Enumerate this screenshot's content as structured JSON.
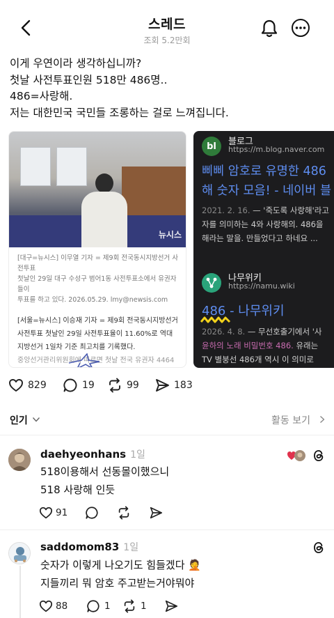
{
  "header": {
    "title": "스레드",
    "views": "조회 5.2만회"
  },
  "post": {
    "lines": [
      "이게 우연이라 생각하십니까?",
      "첫날 사전투표인원 518만 486명..",
      "486=사랑해.",
      "저는 대한민국 국민들 조롱하는 걸로 느껴집니다."
    ],
    "news_card": {
      "photo_mark": "뉴시스",
      "caption": "[대구=뉴시스] 이무열 기자 = 제9회 전국동시지방선거 사전투표 첫날인 29일 대구 수성구 범어1동 사전투표소에서 유권자들이 투표를 하고 있다. 2026.05.29. lmy@newsis.com",
      "caption_lines": [
        "[대구=뉴시스] 이무열 기자 = 제9회 전국동시지방선거 사전투표",
        "첫날인 29일 대구 수성구 범어1동 사전투표소에서 유권자들이",
        "투표를 하고 있다. 2026.05.29. lmy@newsis.com"
      ],
      "article_lines": [
        "[서울=뉴시스] 이승재 기자 = 제9회 전국동시지방선거",
        "사전투표 첫날인 29일 사전투표율이 11.60%로 역대",
        "지방선거 1일차 기준 최고치를 기록했다.",
        "중앙선거관리위원회에 따르면 첫날 전국 유권자 4464"
      ]
    },
    "search_card": {
      "blog_icon": "bl",
      "blog_name": "블로그",
      "blog_url": "https://m.blog.naver.com",
      "blog_title_lines": [
        "삐삐 암호로 유명한 486",
        "해 숫자 모음! - 네이버 블"
      ],
      "blog_date": "2021. 2. 16.",
      "blog_snippet_1": " — '죽도록 사랑해'라고",
      "blog_snippet_2": "자를 의미하는 4와 사랑해의. 486을",
      "blog_snippet_3": "해라는 말을. 만들었다고 하네요 ...",
      "wiki_name": "나무위키",
      "wiki_url": "https://namu.wiki",
      "wiki_title": "486 - 나무위키",
      "wiki_date": "2026. 4. 8.",
      "wiki_snippet_1": " — 무선호출기에서 '사",
      "wiki_snippet_2_hl": "윤하의 노래 비밀번호 486.",
      "wiki_snippet_2_rest": " 유래는",
      "wiki_snippet_3": "TV 별붕선 486개 역시 이 의미로"
    }
  },
  "stats": {
    "likes": "829",
    "comments": "19",
    "reposts": "99",
    "shares": "183"
  },
  "sort": {
    "label": "인기",
    "activity": "활동 보기"
  },
  "comments": [
    {
      "user": "daehyeonhans",
      "time": "1일",
      "lines": [
        "518이용해서 선동몰이했으니",
        "518 사랑해 인듯"
      ],
      "likes": "91"
    },
    {
      "user": "saddomom83",
      "time": "1일",
      "lines": [
        "숫자가 이렇게 나오기도 힘들겠다 🤦",
        "지들끼리 뭐 암호 주고받는거야뭐야"
      ],
      "likes": "88",
      "comments": "1",
      "reposts": "1"
    }
  ],
  "colors": {
    "link_blue": "#5e8df0",
    "dark_card": "#1c1c1e",
    "highlight_pink": "#c86cb0",
    "heart_red": "#e0334d"
  }
}
